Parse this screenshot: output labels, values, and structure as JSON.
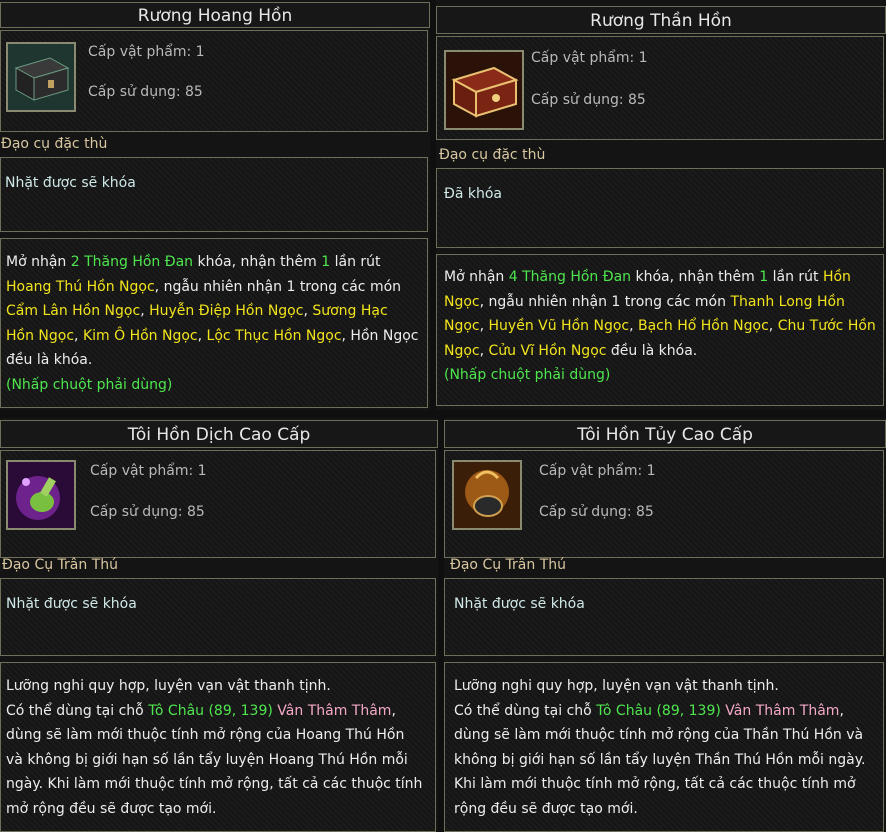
{
  "cards": [
    {
      "title": "Rương Hoang Hồn",
      "icon": "black-chest-icon",
      "item_level": "Cấp vật phẩm: 1",
      "use_level": "Cấp sử dụng: 85",
      "type": "Đạo cụ đặc thù",
      "lock": "Nhặt được sẽ khóa",
      "desc": [
        {
          "t": "Mở nhận ",
          "c": "w"
        },
        {
          "t": "2 Thăng Hồn Đan",
          "c": "g"
        },
        {
          "t": " khóa, nhận thêm ",
          "c": "w"
        },
        {
          "t": "1",
          "c": "g"
        },
        {
          "t": " lần rút ",
          "c": "w"
        },
        {
          "t": "Hoang Thú Hồn Ngọc",
          "c": "y"
        },
        {
          "t": ", ngẫu nhiên nhận 1 trong các món ",
          "c": "w"
        },
        {
          "t": "Cẩm Lân Hồn Ngọc",
          "c": "y"
        },
        {
          "t": ", ",
          "c": "w"
        },
        {
          "t": "Huyễn Điệp Hồn Ngọc",
          "c": "y"
        },
        {
          "t": ", ",
          "c": "w"
        },
        {
          "t": "Sương Hạc Hồn Ngọc",
          "c": "y"
        },
        {
          "t": ", ",
          "c": "w"
        },
        {
          "t": "Kim Ô Hồn Ngọc",
          "c": "y"
        },
        {
          "t": ", ",
          "c": "w"
        },
        {
          "t": "Lộc Thục Hồn Ngọc",
          "c": "y"
        },
        {
          "t": ", Hồn Ngọc đều là khóa.",
          "c": "w"
        }
      ],
      "hint": "(Nhấp chuột phải dùng)"
    },
    {
      "title": "Rương Thần Hồn",
      "icon": "red-gold-chest-icon",
      "item_level": "Cấp vật phẩm: 1",
      "use_level": "Cấp sử dụng: 85",
      "type": "Đạo cụ đặc thù",
      "lock": "Đã khóa",
      "desc": [
        {
          "t": "Mở nhận ",
          "c": "w"
        },
        {
          "t": "4 Thăng Hồn Đan",
          "c": "g"
        },
        {
          "t": " khóa, nhận thêm ",
          "c": "w"
        },
        {
          "t": "1",
          "c": "g"
        },
        {
          "t": " lần rút ",
          "c": "w"
        },
        {
          "t": "Hồn Ngọc",
          "c": "y"
        },
        {
          "t": ", ngẫu nhiên nhận 1 trong các món ",
          "c": "w"
        },
        {
          "t": "Thanh Long Hồn Ngọc",
          "c": "y"
        },
        {
          "t": ", ",
          "c": "w"
        },
        {
          "t": "Huyền Vũ Hồn Ngọc",
          "c": "y"
        },
        {
          "t": ", ",
          "c": "w"
        },
        {
          "t": "Bạch Hổ Hồn Ngọc",
          "c": "y"
        },
        {
          "t": ", ",
          "c": "w"
        },
        {
          "t": "Chu Tước Hồn Ngọc",
          "c": "y"
        },
        {
          "t": ", ",
          "c": "w"
        },
        {
          "t": "Cửu Vĩ Hồn Ngọc",
          "c": "y"
        },
        {
          "t": " đều là khóa.",
          "c": "w"
        }
      ],
      "hint": "(Nhấp chuột phải dùng)"
    },
    {
      "title": "Tôi Hồn Dịch Cao Cấp",
      "icon": "purple-potion-icon",
      "item_level": "Cấp vật phẩm: 1",
      "use_level": "Cấp sử dụng: 85",
      "type": "Đạo Cụ Trân Thú",
      "lock": "Nhặt được sẽ khóa",
      "desc": [
        {
          "t": "Lưỡng nghi quy hợp, luyện vạn vật thanh tịnh.",
          "c": "w",
          "br": true
        },
        {
          "t": "Có thể dùng tại chỗ ",
          "c": "w"
        },
        {
          "t": "Tô Châu (89, 139)",
          "c": "g"
        },
        {
          "t": " ",
          "c": "w"
        },
        {
          "t": "Vân Thâm Thâm",
          "c": "p"
        },
        {
          "t": ", dùng sẽ làm mới thuộc tính mở rộng của Hoang Thú Hồn và không bị giới hạn số lần tẩy luyện Hoang Thú Hồn mỗi ngày. Khi làm mới thuộc tính mở rộng, tất cả các thuộc tính mở rộng đều sẽ được tạo mới.",
          "c": "w"
        }
      ],
      "hint": ""
    },
    {
      "title": "Tôi Hồn Tủy Cao Cấp",
      "icon": "golden-cauldron-icon",
      "item_level": "Cấp vật phẩm: 1",
      "use_level": "Cấp sử dụng: 85",
      "type": "Đạo Cụ Trân Thú",
      "lock": "Nhặt được sẽ khóa",
      "desc": [
        {
          "t": "Lưỡng nghi quy hợp, luyện vạn vật thanh tịnh.",
          "c": "w",
          "br": true
        },
        {
          "t": "Có thể dùng tại chỗ ",
          "c": "w"
        },
        {
          "t": "Tô Châu (89, 139)",
          "c": "g"
        },
        {
          "t": " ",
          "c": "w"
        },
        {
          "t": "Vân Thâm Thâm",
          "c": "p"
        },
        {
          "t": ", dùng sẽ làm mới thuộc tính mở rộng của Thần Thú Hồn và không bị giới hạn số lần tẩy luyện Thần Thú Hồn mỗi ngày. Khi làm mới thuộc tính mở rộng, tất cả các thuộc tính mở rộng đều sẽ được tạo mới.",
          "c": "w"
        }
      ],
      "hint": ""
    }
  ]
}
